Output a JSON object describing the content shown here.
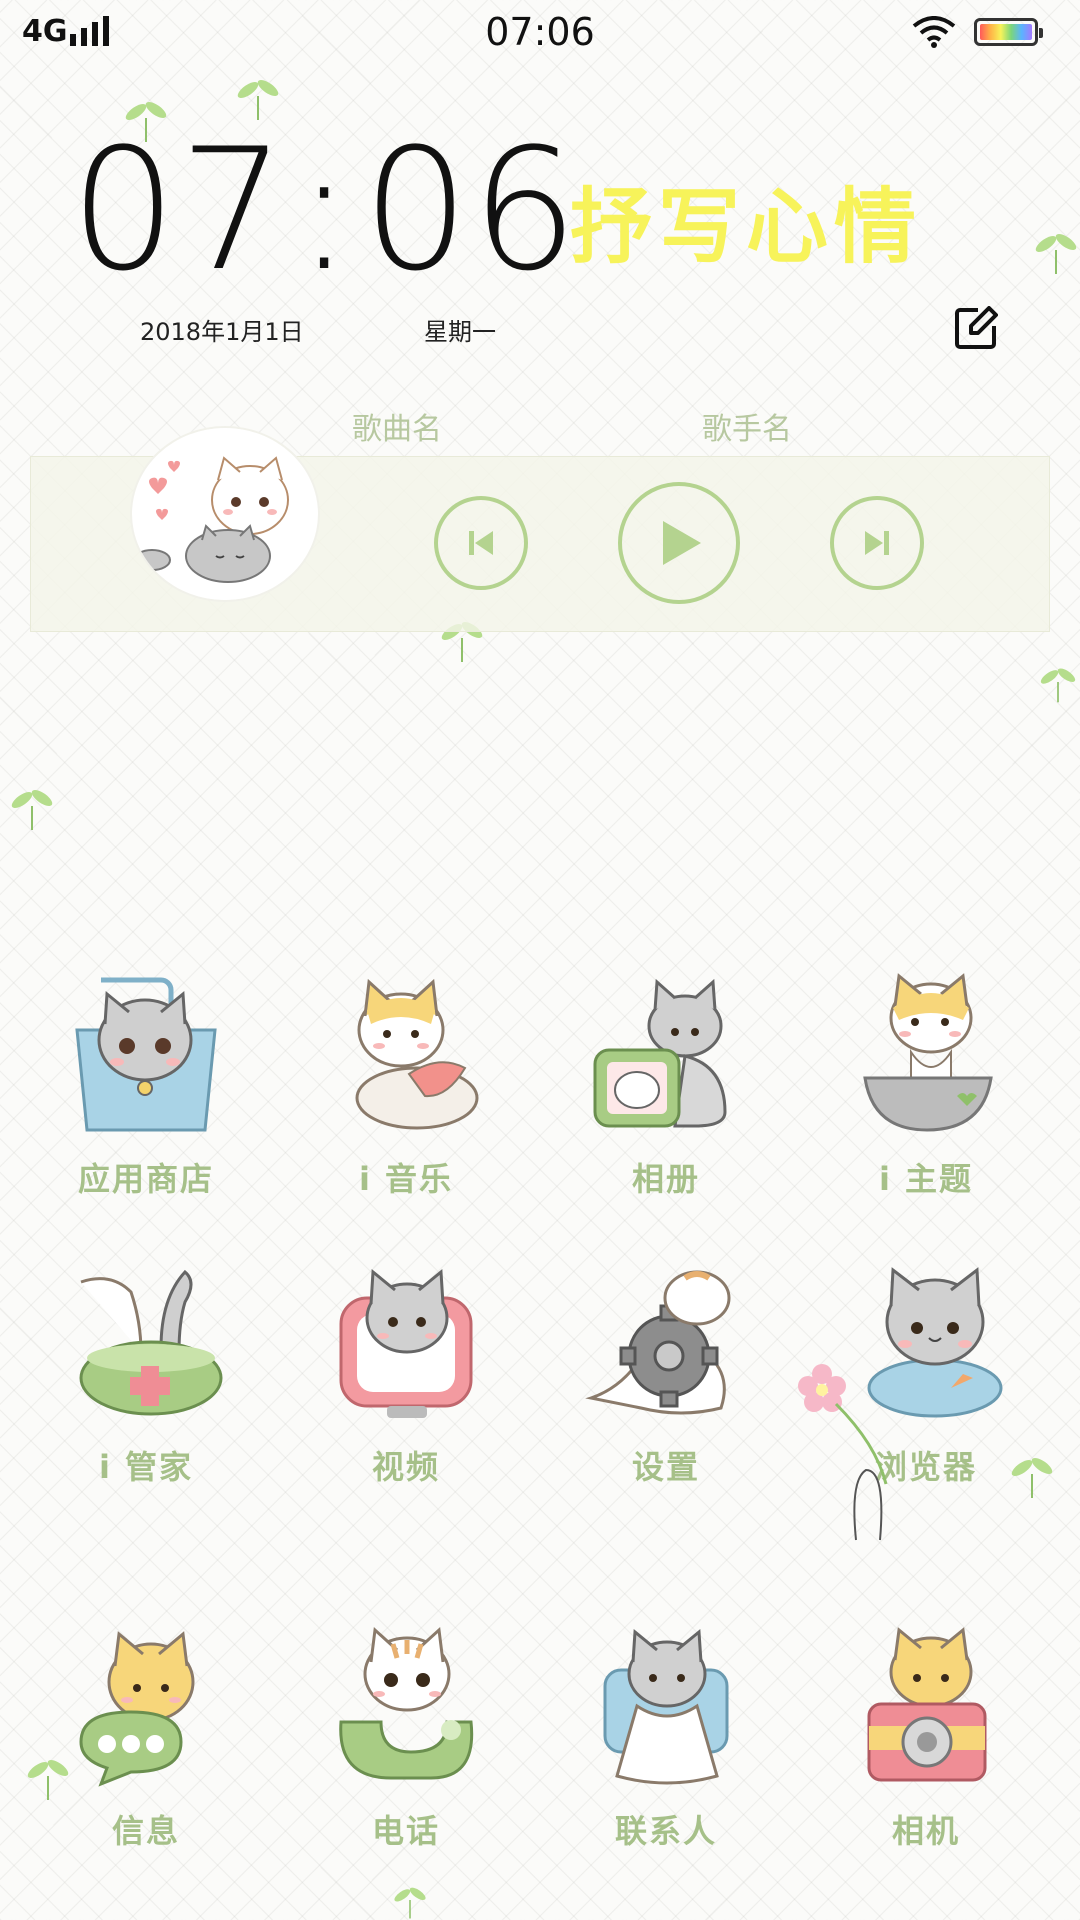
{
  "status_bar": {
    "network": "4G",
    "time": "07:06",
    "icons": [
      "signal-icon",
      "wifi-icon",
      "battery-icon"
    ]
  },
  "clock_widget": {
    "hours": "07",
    "separator": ":",
    "minutes": "06",
    "mood_text": "抒写心情",
    "date": "2018年1月1日",
    "weekday": "星期一",
    "edit_icon": "edit-icon"
  },
  "music_widget": {
    "song_name": "歌曲名",
    "artist_name": "歌手名",
    "controls": [
      "previous-icon",
      "play-icon",
      "next-icon"
    ]
  },
  "apps": [
    {
      "label": "应用商店",
      "icon": "app-store-cat-icon"
    },
    {
      "label": "i 音乐",
      "icon": "music-cat-icon"
    },
    {
      "label": "相册",
      "icon": "album-cat-icon"
    },
    {
      "label": "i 主题",
      "icon": "theme-cat-icon"
    },
    {
      "label": "i 管家",
      "icon": "manager-cat-icon"
    },
    {
      "label": "视频",
      "icon": "video-cat-icon"
    },
    {
      "label": "设置",
      "icon": "settings-cat-icon"
    },
    {
      "label": "浏览器",
      "icon": "browser-cat-icon"
    },
    {
      "label": "信息",
      "icon": "messages-cat-icon"
    },
    {
      "label": "电话",
      "icon": "phone-cat-icon"
    },
    {
      "label": "联系人",
      "icon": "contacts-cat-icon"
    },
    {
      "label": "相机",
      "icon": "camera-cat-icon"
    }
  ],
  "colors": {
    "mood_text": "#f7f35a",
    "label_green": "#a6c089",
    "control_green": "#b4d38f",
    "music_title": "#b7c8a0"
  }
}
